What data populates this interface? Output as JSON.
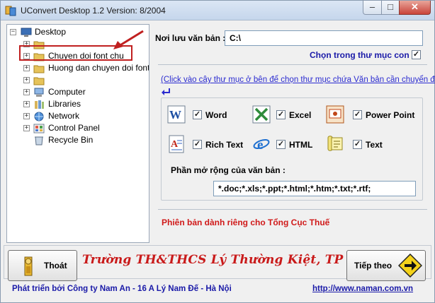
{
  "window": {
    "title": "UConvert Desktop 1.2   Version: 8/2004",
    "minimize": "–",
    "maximize": "□",
    "close": "✕"
  },
  "tree": {
    "root": "Desktop",
    "items": [
      {
        "label": "",
        "icon": "user-folder-icon"
      },
      {
        "label": "Chuyen doi font chu",
        "icon": "folder-icon"
      },
      {
        "label": "Huong dan chuyen doi font ch",
        "icon": "folder-icon"
      },
      {
        "label": "",
        "icon": "folder-icon"
      },
      {
        "label": "Computer",
        "icon": "computer-icon"
      },
      {
        "label": "Libraries",
        "icon": "libraries-icon"
      },
      {
        "label": "Network",
        "icon": "network-icon"
      },
      {
        "label": "Control Panel",
        "icon": "control-panel-icon"
      },
      {
        "label": "Recycle Bin",
        "icon": "recycle-bin-icon"
      }
    ]
  },
  "panel": {
    "path_label": "Nơi lưu văn bản :",
    "path_value": "C:\\",
    "choose_subfolder": "Chọn trong thư mục con",
    "hint": "(Click vào cây thư mục ở bên để chọn thư mục chứa Văn bản cần chuyển đổi)",
    "formats": [
      {
        "name": "Word",
        "checked": true
      },
      {
        "name": "Excel",
        "checked": true
      },
      {
        "name": "Power Point",
        "checked": true
      },
      {
        "name": "Rich Text",
        "checked": true
      },
      {
        "name": "HTML",
        "checked": true
      },
      {
        "name": "Text",
        "checked": true
      }
    ],
    "ext_label": "Phần mở rộng của văn bản :",
    "ext_value": "*.doc;*.xls;*.ppt;*.html;*.htm;*.txt;*.rtf;",
    "license": "Phiên bản dành riêng cho Tổng Cục Thuế"
  },
  "footer": {
    "exit_label": "Thoát",
    "next_label": "Tiếp theo",
    "school": "Trường TH&THCS Lý Thường Kiệt, TP Sóc Trăng",
    "developer": "Phát triển bởi Công ty Nam An - 16 A Lý Nam Đế - Hà Nội",
    "url": "http://www.naman.com.vn"
  },
  "colors": {
    "accent_blue": "#1a1aa8",
    "accent_red": "#c91a1a",
    "link": "#2b2bd0"
  }
}
